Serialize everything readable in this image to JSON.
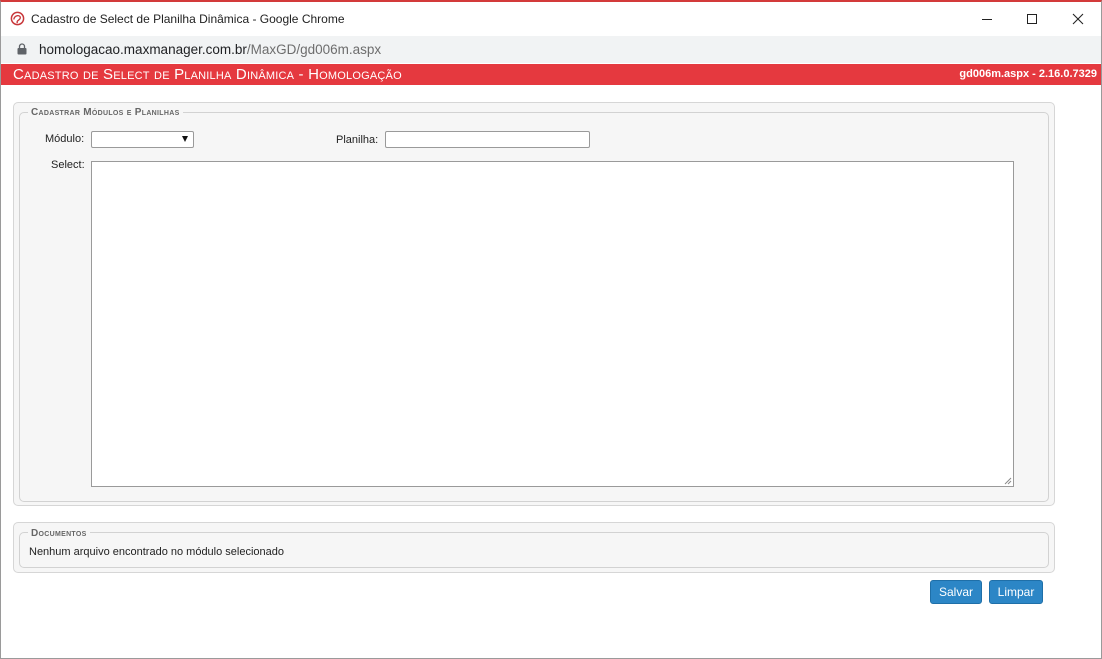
{
  "window": {
    "title": "Cadastro de Select de Planilha Dinâmica - Google Chrome",
    "icons": {
      "app": "app-logo-icon",
      "minimize": "minimize-icon",
      "maximize": "maximize-icon",
      "close": "close-icon"
    }
  },
  "address_bar": {
    "host": "homologacao.maxmanager.com.br",
    "path": "/MaxGD/gd006m.aspx",
    "lock_icon": "lock-icon"
  },
  "page_header": {
    "title": "Cadastro de Select de Planilha Dinâmica  - Homologação",
    "version": "gd006m.aspx - 2.16.0.7329",
    "color": "#e5393f"
  },
  "form_section": {
    "legend": "Cadastrar Módulos e Planilhas",
    "modulo_label": "Módulo:",
    "modulo_value": "",
    "planilha_label": "Planilha:",
    "planilha_value": "",
    "select_label": "Select:",
    "select_value": ""
  },
  "documents_section": {
    "legend": "Documentos",
    "empty_message": "Nenhum arquivo encontrado no módulo selecionado"
  },
  "actions": {
    "save_label": "Salvar",
    "clear_label": "Limpar",
    "button_color": "#2c86c6"
  }
}
